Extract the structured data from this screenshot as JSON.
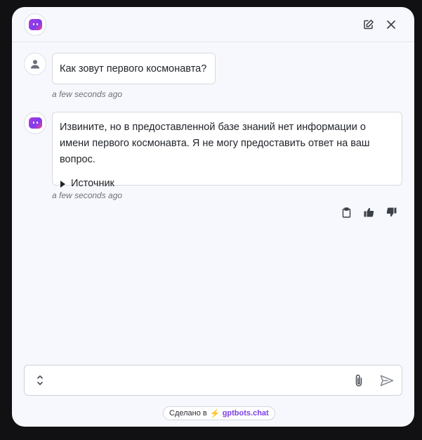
{
  "header": {
    "avatar_icon": "bot-logo-icon",
    "edit_icon": "edit-icon",
    "close_icon": "close-icon"
  },
  "messages": [
    {
      "role": "user",
      "avatar_icon": "user-icon",
      "text": "Как зовут первого космонавта?",
      "time": "a few seconds ago"
    },
    {
      "role": "bot",
      "avatar_icon": "bot-logo-icon",
      "text": "Извините, но в предоставленной базе знаний нет информации о имени первого космонавта. Я не могу предоставить ответ на ваш вопрос.",
      "source_label": "Источник",
      "time": "a few seconds ago"
    }
  ],
  "actions": [
    "clipboard-icon",
    "thumbs-up-icon",
    "thumbs-down-icon"
  ],
  "composer": {
    "value": "",
    "placeholder": ""
  },
  "footer": {
    "prefix": "Сделано в",
    "brand": "gptbots.chat"
  },
  "colors": {
    "accent": "#7b3fe4",
    "bolt": "#f2b01e",
    "window_bg": "#f7f8fd",
    "page_bg": "#111113"
  }
}
